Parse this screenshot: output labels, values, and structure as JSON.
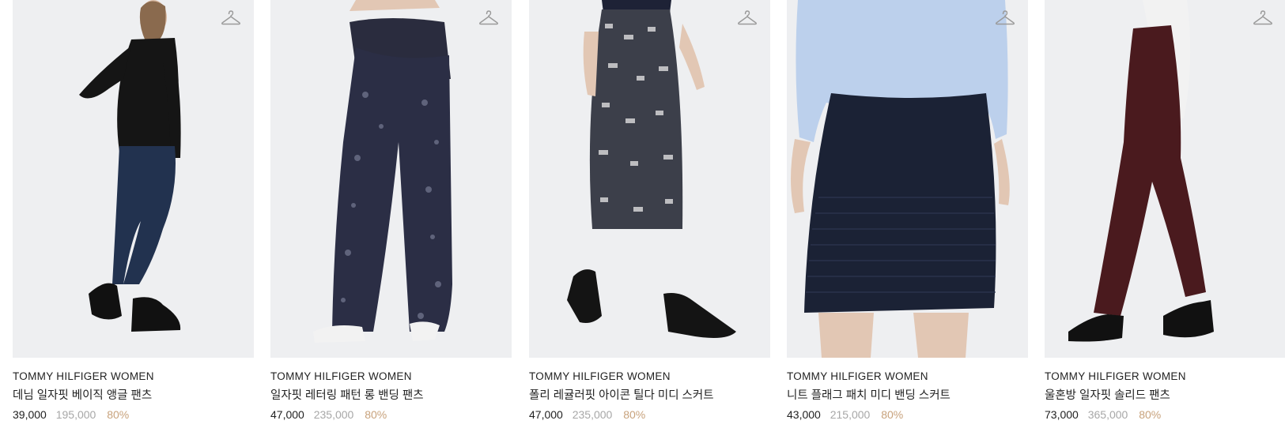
{
  "colors": {
    "background": "#ffffff",
    "thumb_bg": "#eeeff1",
    "text": "#222222",
    "original_price": "#a7a7a7",
    "discount": "#c8a27c"
  },
  "products": [
    {
      "brand": "TOMMY HILFIGER WOMEN",
      "name": "데님 일자핏 베이직 앵글 팬츠",
      "price": "39,000",
      "original_price": "195,000",
      "discount": "80%",
      "wishlist_icon": "hanger-icon",
      "image_alt": "black turtleneck with dark denim cropped jeans and black boots"
    },
    {
      "brand": "TOMMY HILFIGER WOMEN",
      "name": "일자핏 레터링 패턴 롱 밴딩 팬츠",
      "price": "47,000",
      "original_price": "235,000",
      "discount": "80%",
      "wishlist_icon": "hanger-icon",
      "image_alt": "navy patterned wide leg pants with white sneakers"
    },
    {
      "brand": "TOMMY HILFIGER WOMEN",
      "name": "폴리 레귤러핏 아이콘 틸다 미디 스커트",
      "price": "47,000",
      "original_price": "235,000",
      "discount": "80%",
      "wishlist_icon": "hanger-icon",
      "image_alt": "black and white patterned midi skirt with black ankle boots"
    },
    {
      "brand": "TOMMY HILFIGER WOMEN",
      "name": "니트 플래그 패치 미디 밴딩 스커트",
      "price": "43,000",
      "original_price": "215,000",
      "discount": "80%",
      "wishlist_icon": "hanger-icon",
      "image_alt": "light blue shirt with navy ribbed knit skirt"
    },
    {
      "brand": "TOMMY HILFIGER WOMEN",
      "name": "울혼방 일자핏 솔리드 팬츠",
      "price": "73,000",
      "original_price": "365,000",
      "discount": "80%",
      "wishlist_icon": "hanger-icon",
      "image_alt": "burgundy straight pants with black heeled boots"
    }
  ]
}
